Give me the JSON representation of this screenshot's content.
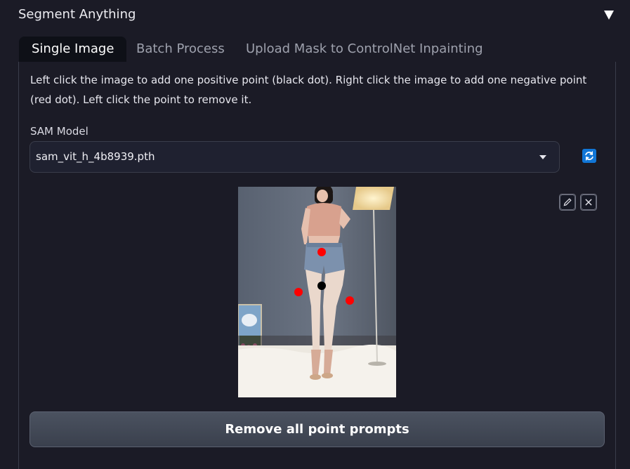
{
  "accordion": {
    "title": "Segment Anything"
  },
  "tabs": [
    {
      "label": "Single Image",
      "active": true
    },
    {
      "label": "Batch Process",
      "active": false
    },
    {
      "label": "Upload Mask to ControlNet Inpainting",
      "active": false
    }
  ],
  "instructions": "Left click the image to add one positive point (black dot). Right click the image to add one negative point (red dot). Left click the point to remove it.",
  "sam_model": {
    "label": "SAM Model",
    "value": "sam_vit_h_4b8939.pth"
  },
  "image_tools": {
    "edit_icon": "pencil-icon",
    "clear_icon": "close-icon"
  },
  "point_prompts": {
    "positive_color": "#000000",
    "negative_color": "#ff0000"
  },
  "buttons": {
    "remove_all": "Remove all point prompts"
  },
  "colors": {
    "accent": "#1176d6",
    "background": "#1b1b26"
  }
}
